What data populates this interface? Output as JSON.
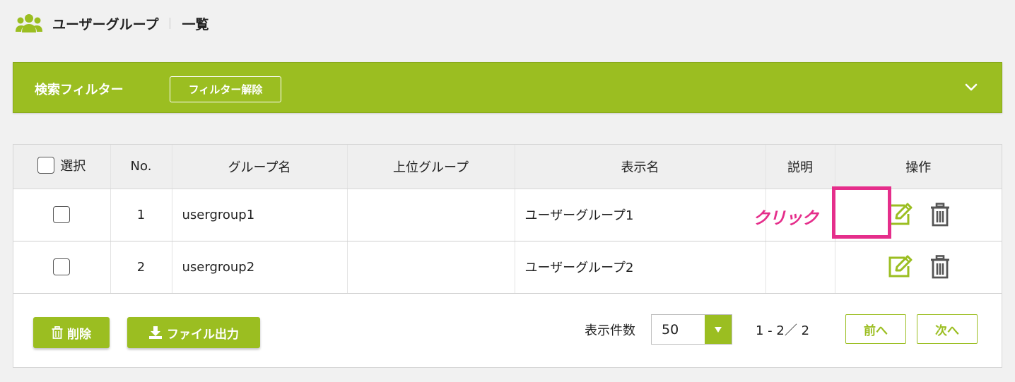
{
  "header": {
    "title": "ユーザーグループ",
    "subtitle": "一覧",
    "icon": "users-icon"
  },
  "filter": {
    "title": "検索フィルター",
    "clear_label": "フィルター解除",
    "toggle_icon": "chevron-down-icon"
  },
  "table": {
    "columns": [
      "選択",
      "No.",
      "グループ名",
      "上位グループ",
      "表示名",
      "説明",
      "操作"
    ],
    "rows": [
      {
        "no": "1",
        "group_name": "usergroup1",
        "parent_group": "",
        "display_name": "ユーザーグループ1",
        "description": ""
      },
      {
        "no": "2",
        "group_name": "usergroup2",
        "parent_group": "",
        "display_name": "ユーザーグループ2",
        "description": ""
      }
    ]
  },
  "annotation": {
    "click_label": "クリック",
    "color": "#e52e8b"
  },
  "footer": {
    "delete_label": "削除",
    "export_label": "ファイル出力",
    "per_page_label": "表示件数",
    "per_page_value": "50",
    "range_text": "1 - 2／ 2",
    "prev_label": "前へ",
    "next_label": "次へ"
  },
  "colors": {
    "accent": "#9bbe21",
    "highlight": "#e52e8b",
    "background": "#f1f1f1"
  }
}
